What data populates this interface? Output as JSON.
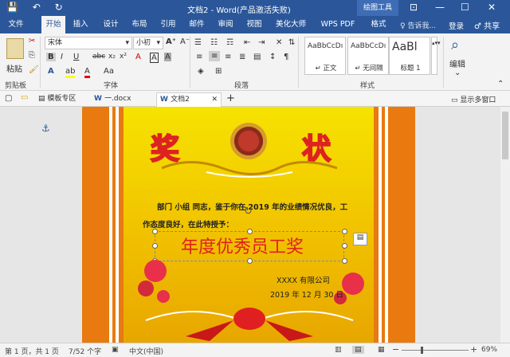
{
  "titlebar": {
    "title": "文档2 - Word(产品激活失败)",
    "context_label": "绘图工具",
    "save_icon": "💾",
    "undo_icon": "↶",
    "redo_icon": "↻",
    "help_icon": "⊡",
    "min_icon": "—",
    "max_icon": "☐",
    "close_icon": "✕"
  },
  "tabs": [
    "文件",
    "开始",
    "插入",
    "设计",
    "布局",
    "引用",
    "邮件",
    "审阅",
    "视图",
    "美化大师",
    "WPS PDF",
    "格式"
  ],
  "tellme": "♀ 告诉我...",
  "login": "登录",
  "share": "♂ 共享",
  "ribbon": {
    "paste_label": "粘贴",
    "clipboard_label": "剪贴板",
    "font_label": "字体",
    "para_label": "段落",
    "styles_label": "样式",
    "edit_label": "编辑",
    "font_name": "宋体",
    "font_size": "小初",
    "font_name_arrow": "▾",
    "font_size_arrow": "▾",
    "bold": "B",
    "italic": "I",
    "underline": "U",
    "strike": "abc",
    "sub": "x₂",
    "sup": "x²",
    "font_grow": "A⁺",
    "font_shrink": "A⁻",
    "font_aa": "Aa",
    "clear_format": "A",
    "char_border": "A",
    "char_shade": "A",
    "highlight": "ab",
    "font_color": "A",
    "styles": [
      {
        "preview": "AaBbCcDı",
        "name": "↵ 正文"
      },
      {
        "preview": "AaBbCcDı",
        "name": "↵ 无间隔"
      },
      {
        "preview": "AaBl",
        "name": "标题 1"
      }
    ]
  },
  "doctabs": [
    "模板专区",
    "一.docx",
    "文档2"
  ],
  "add_tab": "+",
  "multi_window": "显示多窗口",
  "certificate": {
    "left_char": "奖",
    "right_char": "状",
    "line1": "部门    小组    同志，鉴于你在 2019 年的业绩情况优良，工",
    "line2": "作态度良好，在此特授予：",
    "award": "年度优秀员工奖",
    "company": "XXXX 有限公司",
    "date": "2019 年 12 月 30 日"
  },
  "status": {
    "page": "第 1 页，共 1 页",
    "words": "7/52 个字",
    "lang": "中文(中国)",
    "zoom": "69%",
    "zoom_out": "−",
    "zoom_in": "+"
  },
  "colors": {
    "accent": "#2b579a",
    "red": "#e02020",
    "orange": "#e87a10"
  }
}
